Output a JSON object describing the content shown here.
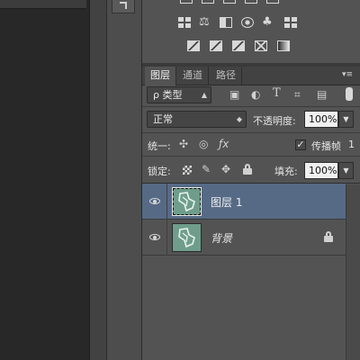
{
  "colors": {
    "panel_bg": "#535353",
    "canvas_bg": "#282828",
    "selected_row": "#566a86",
    "thumbnail": "#6f9d8c"
  },
  "adjustments": {
    "row1_icons": [
      "channel-mixer-icon",
      "color-balance-icon",
      "black-white-icon",
      "photo-filter-icon",
      "channel-icon",
      "color-lookup-icon"
    ],
    "row2_icons": [
      "invert-icon",
      "posterize-icon",
      "threshold-icon",
      "selective-color-icon",
      "gradient-map-icon"
    ]
  },
  "tabs": [
    {
      "label": "图层",
      "active": true
    },
    {
      "label": "通道",
      "active": false
    },
    {
      "label": "路径",
      "active": false
    }
  ],
  "filter": {
    "kind_label": "ρ 类型",
    "icons": [
      "pixel-filter-icon",
      "adjustment-filter-icon",
      "type-filter-icon",
      "shape-filter-icon",
      "smart-object-filter-icon",
      "toggle-filter-icon"
    ]
  },
  "blend": {
    "mode": "正常",
    "opacity_label": "不透明度:",
    "opacity_value": "100%"
  },
  "unify": {
    "label": "统一:",
    "propagate_label": "传播帧",
    "propagate_value": "1",
    "propagate_checked": true
  },
  "lock": {
    "label": "锁定:",
    "fill_label": "填充:",
    "fill_value": "100%"
  },
  "layers": [
    {
      "name": "图层 1",
      "selected": true,
      "visible": true,
      "locked": false
    },
    {
      "name": "背景",
      "selected": false,
      "visible": true,
      "locked": true
    }
  ]
}
